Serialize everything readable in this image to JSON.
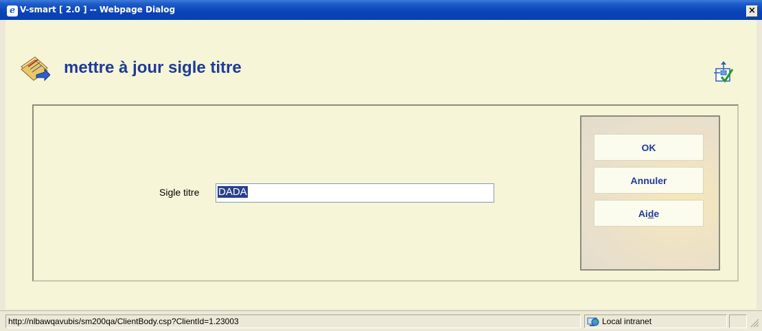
{
  "window": {
    "title": "V-smart [ 2.0 ] -- Webpage Dialog",
    "app_icon": "ie-icon",
    "close_label": "×"
  },
  "page": {
    "title": "mettre à jour sigle titre",
    "header_icon": "newspaper-edit-icon",
    "corner_icon": "layout-check-icon"
  },
  "form": {
    "label": "Sigle titre",
    "value": "DADA"
  },
  "buttons": {
    "ok": "OK",
    "cancel": "Annuler",
    "help_prefix": "Ai",
    "help_accel": "d",
    "help_suffix": "e"
  },
  "statusbar": {
    "url": "http://nlbawqavubis/sm200qa/ClientBody.csp?ClientId=1.23003",
    "zone": "Local intranet",
    "zone_icon": "globe-computer-icon"
  }
}
